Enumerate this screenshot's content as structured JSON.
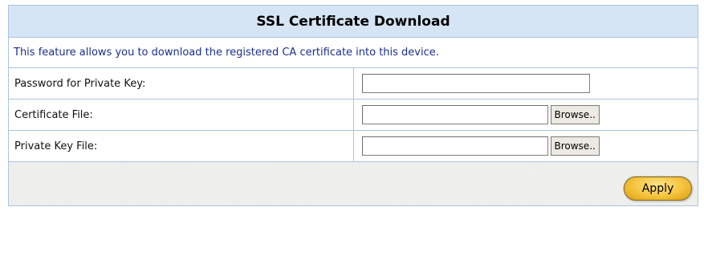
{
  "panel": {
    "title": "SSL Certificate Download",
    "description": "This feature allows you to download the registered CA certificate into this device."
  },
  "fields": {
    "password": {
      "label": "Password for Private Key:",
      "value": ""
    },
    "certificate_file": {
      "label": "Certificate File:",
      "value": "",
      "browse_label": "Browse.."
    },
    "private_key_file": {
      "label": "Private Key File:",
      "value": "",
      "browse_label": "Browse.."
    }
  },
  "footer": {
    "apply_label": "Apply"
  },
  "colors": {
    "header_bg": "#d6e5f5",
    "border": "#a9c4e0",
    "description_text": "#1a2f8f",
    "apply_button": "#f5c33c"
  }
}
